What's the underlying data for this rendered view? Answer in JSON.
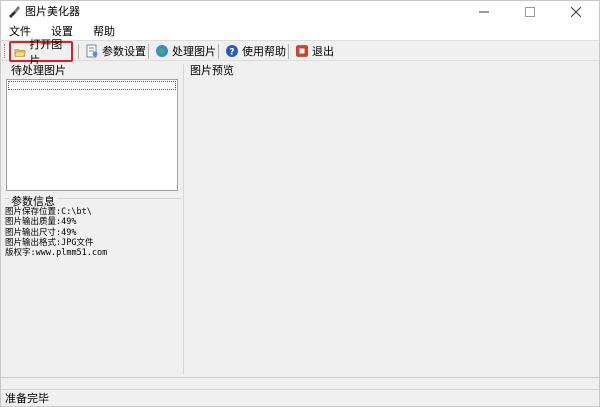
{
  "window": {
    "title": "图片美化器",
    "app_icon": "paintbrush-icon",
    "controls": [
      "minimize-icon",
      "maximize-icon",
      "close-icon"
    ]
  },
  "menu": {
    "items": [
      "文件",
      "设置",
      "帮助"
    ]
  },
  "toolbar": {
    "buttons": [
      {
        "label": "打开图片",
        "icon": "folder-open-icon",
        "highlighted": true
      },
      {
        "label": "参数设置",
        "icon": "settings-document-icon"
      },
      {
        "label": "处理图片",
        "icon": "process-image-icon"
      },
      {
        "label": "使用帮助",
        "icon": "help-icon"
      },
      {
        "label": "退出",
        "icon": "exit-icon"
      }
    ],
    "highlight_color": "#e02020"
  },
  "left_panel": {
    "pending_title": "待处理图片",
    "params_title": "参数信息",
    "params": [
      "图片保存位置:C:\\bt\\",
      "图片输出质量:49%",
      "图片输出尺寸:49%",
      "图片输出格式:JPG文件",
      "版权字:www.plmm51.com"
    ]
  },
  "right_panel": {
    "preview_title": "图片预览"
  },
  "status": {
    "text": "准备完毕"
  }
}
